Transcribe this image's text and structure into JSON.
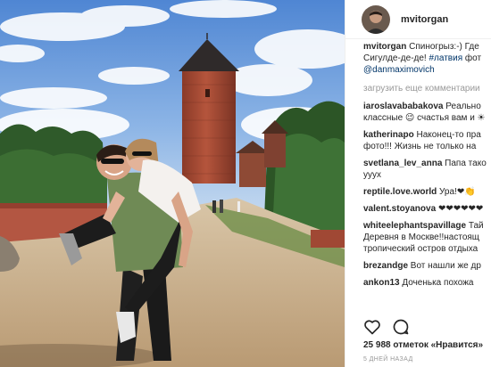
{
  "post": {
    "username": "mvitorgan",
    "avatar_icon": "user-avatar-portrait",
    "photo_description_icon": "post-photo"
  },
  "caption": {
    "author": "mvitorgan",
    "line1_text": "Спиногрыз:-) Где",
    "line2_text": "Сигулде-де-де!",
    "hashtag": "#латвия",
    "line2_tail": "фот",
    "mention": "@danmaximovich"
  },
  "load_more": "загрузить еще комментарии",
  "comments": [
    {
      "user": "iaroslavababakova",
      "lines": [
        "Реально",
        "классные 😉 счастья вам и ☀"
      ]
    },
    {
      "user": "katherinapo",
      "lines": [
        "Наконец-то пра",
        "фото!!! Жизнь не только на"
      ]
    },
    {
      "user": "svetlana_lev_anna",
      "lines": [
        "Папа тако",
        "уууx"
      ]
    },
    {
      "user": "reptile.love.world",
      "lines": [
        "Ура!❤👏"
      ]
    },
    {
      "user": "valent.stoyanova",
      "lines": [
        "❤❤❤❤❤❤"
      ]
    },
    {
      "user": "whiteelephantspavillage",
      "lines": [
        "Тай",
        "Деревня в Москве!!настоящ",
        "тропический остров отдыха"
      ]
    },
    {
      "user": "brezandge",
      "lines": [
        "Вот нашли же др"
      ]
    },
    {
      "user": "ankon13",
      "lines": [
        "Доченька похожа"
      ]
    }
  ],
  "actions": {
    "like_icon": "heart-outline-icon",
    "comment_icon": "speech-bubble-icon"
  },
  "likes_text": "25 988 отметок «Нравится»",
  "timestamp": "5 ДНЕЙ НАЗАД",
  "colors": {
    "text": "#262626",
    "muted": "#999999",
    "link": "#003569",
    "sky": "#5b8fd6",
    "tower": "#a94a34"
  }
}
